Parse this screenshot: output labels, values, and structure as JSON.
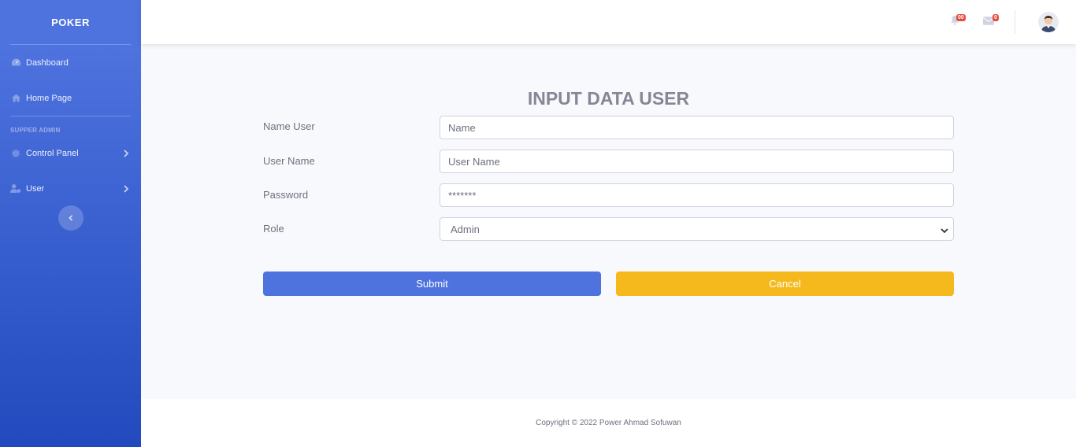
{
  "sidebar": {
    "brand": "POKER",
    "items": [
      {
        "label": "Dashboard",
        "icon": "tachometer-icon"
      },
      {
        "label": "Home Page",
        "icon": "home-icon"
      }
    ],
    "heading": "SUPPER ADMIN",
    "admin_items": [
      {
        "label": "Control Panel",
        "icon": "gear-icon"
      },
      {
        "label": "User",
        "icon": "user-cog-icon"
      }
    ]
  },
  "topbar": {
    "alerts_badge": "00",
    "messages_badge": "0"
  },
  "form": {
    "title": "INPUT DATA USER",
    "name_label": "Name User",
    "name_placeholder": "Name",
    "username_label": "User Name",
    "username_placeholder": "User Name",
    "password_label": "Password",
    "password_value": "*******",
    "role_label": "Role",
    "role_value": "Admin",
    "submit_label": "Submit",
    "cancel_label": "Cancel"
  },
  "footer": {
    "copyright": "Copyright © 2022 Power Ahmad Sofuwan"
  },
  "colors": {
    "primary": "#4e73df",
    "warning": "#f6b91d",
    "danger": "#e74a3b"
  }
}
